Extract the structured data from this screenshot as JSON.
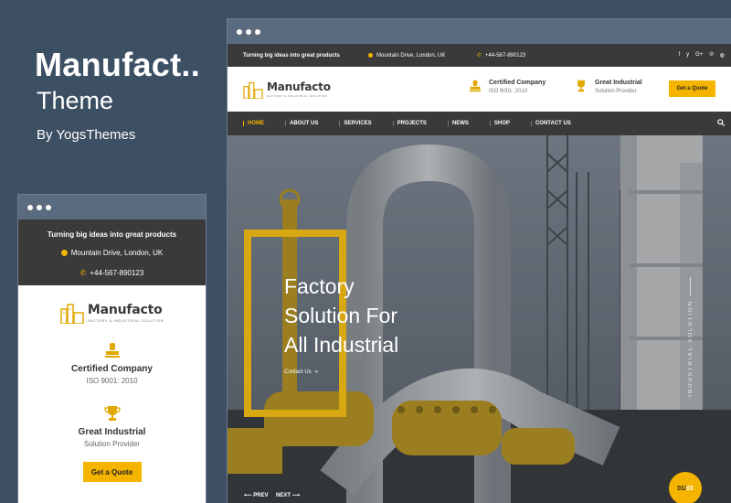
{
  "promo": {
    "title": "Manufact..",
    "subtitle": "Theme",
    "author": "By YogsThemes"
  },
  "colors": {
    "background": "#3d4f63",
    "accent": "#f5b400",
    "topbar": "#3a3a3a",
    "window_bar": "#5a6b7f"
  },
  "site": {
    "tagline": "Turning big ideas into great products",
    "address": "Mountain Drive, London, UK",
    "phone": "+44-567-890123",
    "logo": "Manufacto",
    "logo_tag": "FACTORY & INDUSTRIAL SOLUTION",
    "features": [
      {
        "title": "Certified Company",
        "sub": "ISO 9001: 2010",
        "icon": "stamp-icon"
      },
      {
        "title": "Great Industrial",
        "sub": "Solution Provider",
        "icon": "trophy-icon"
      }
    ],
    "quote_button": "Get a Quote",
    "social_icons": [
      "facebook-icon",
      "twitter-icon",
      "google-plus-icon",
      "pinterest-icon",
      "globe-icon"
    ],
    "social_glyphs": [
      "f",
      "y",
      "G+",
      "℗",
      "◍"
    ]
  },
  "nav": {
    "items": [
      "HOME",
      "ABOUT US",
      "SERVICES",
      "PROJECTS",
      "NEWS",
      "SHOP",
      "CONTACT US"
    ],
    "active": 0
  },
  "hero": {
    "lines": [
      "Factory",
      "Solution For",
      "All Industrial"
    ],
    "contact": "Contact Us",
    "side_text": "INDUSTRIAL SOLUTION",
    "prev": "PREV",
    "next": "NEXT",
    "slide_current": "01/",
    "slide_total": "03"
  }
}
